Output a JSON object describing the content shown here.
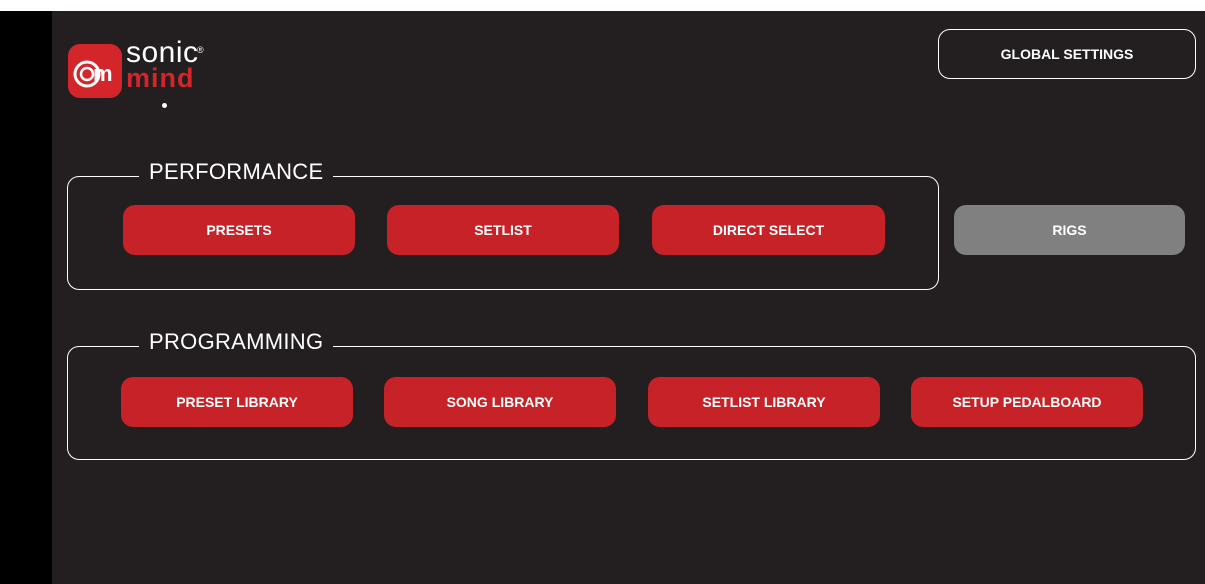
{
  "brand": {
    "name_top": "sonic",
    "registered_mark": "®",
    "name_bottom": "mind",
    "accent_color": "#c72227"
  },
  "header": {
    "global_settings_label": "GLOBAL SETTINGS"
  },
  "performance": {
    "title": "PERFORMANCE",
    "buttons": [
      "PRESETS",
      "SETLIST",
      "DIRECT SELECT"
    ]
  },
  "rigs": {
    "label": "RIGS",
    "state": "disabled",
    "color": "#808080"
  },
  "programming": {
    "title": "PROGRAMMING",
    "buttons": [
      "PRESET LIBRARY",
      "SONG LIBRARY",
      "SETLIST LIBRARY",
      "SETUP PEDALBOARD"
    ]
  }
}
